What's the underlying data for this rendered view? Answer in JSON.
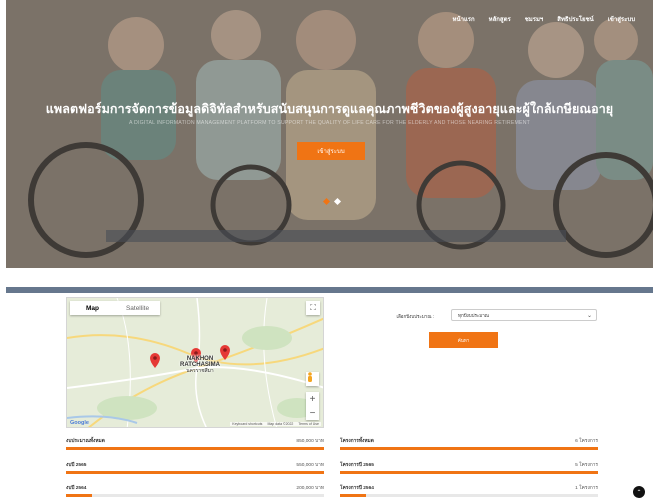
{
  "nav": [
    "หน้าแรก",
    "หลักสูตร",
    "ชมรมฯ",
    "สิทธิประโยชน์",
    "เข้าสู่ระบบ"
  ],
  "hero": {
    "title": "แพลตฟอร์มการจัดการข้อมูลดิจิทัลสำหรับสนับสนุนการดูแลคุณภาพชีวิตของผู้สูงอายุและผู้ใกล้เกษียณอายุ",
    "subtitle": "A DIGITAL INFORMATION MANAGEMENT PLATFORM TO SUPPORT THE QUALITY OF LIFE CARE FOR THE ELDERLY AND THOSE NEARING RETIREMENT",
    "button": "เข้าสู่ระบบ",
    "slide_count": 2,
    "active_slide": 1
  },
  "map": {
    "tab_map": "Map",
    "tab_satellite": "Satellite",
    "city_en": "NAKHON RATCHASIMA",
    "city_th": "นครราชสีมา",
    "google": "Google",
    "footer": [
      "Keyboard shortcuts",
      "Map data ©2022",
      "Terms of Use"
    ],
    "markers": 3
  },
  "filter": {
    "label": "เลือกปีงบประมาณ :",
    "selected": "ทุกปีงบประมาณ",
    "button": "ค้นหา"
  },
  "stats_left": [
    {
      "label": "งบประมาณทั้งหมด",
      "value": "850,000 บาท",
      "progress": 100
    },
    {
      "label": "งบปี 2565",
      "value": "550,000 บาท",
      "progress": 100
    },
    {
      "label": "งบปี 2564",
      "value": "200,000 บาท",
      "progress": 10
    }
  ],
  "stats_right": [
    {
      "label": "โครงการทั้งหมด",
      "value": "6 โครงการ",
      "progress": 100
    },
    {
      "label": "โครงการปี 2565",
      "value": "5 โครงการ",
      "progress": 100
    },
    {
      "label": "โครงการปี 2564",
      "value": "1 โครงการ",
      "progress": 10
    }
  ],
  "colors": {
    "accent": "#f07414",
    "divider": "#66778d",
    "dot_active": "#f07414",
    "dot_inactive": "#ffffff"
  },
  "icons": {
    "fullscreen": "fullscreen-icon",
    "pegman": "pegman-icon",
    "scroll_top": "chevron-up-icon",
    "marker": "map-marker-icon"
  }
}
